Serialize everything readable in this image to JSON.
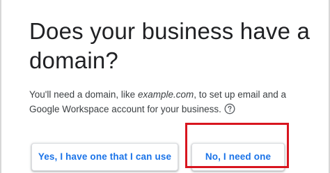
{
  "heading": "Does your business have a domain?",
  "description": {
    "before": "You'll need a domain, like ",
    "example": "example.com",
    "after": ", to set up email and a Google Workspace account for your business."
  },
  "help_icon": "help-circle-icon",
  "buttons": {
    "yes_label": "Yes, I have one that I can use",
    "no_label": "No, I need one"
  },
  "colors": {
    "accent": "#1a73e8",
    "highlight": "#d8151f",
    "text": "#202124"
  }
}
